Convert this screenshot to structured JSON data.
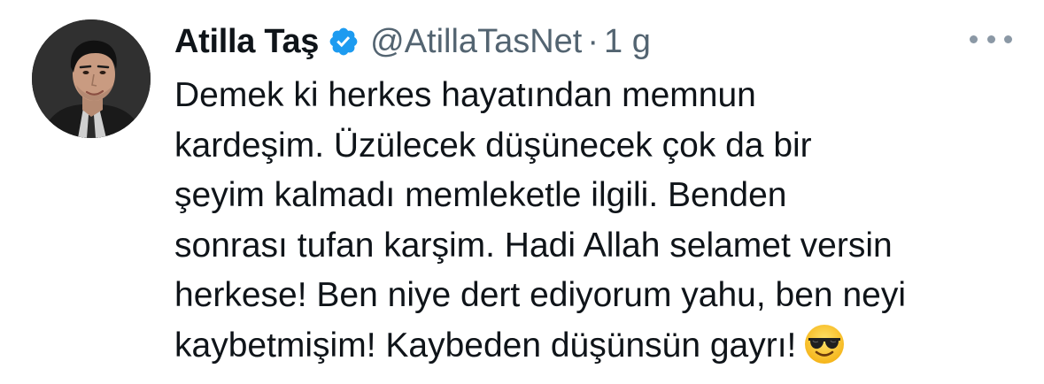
{
  "tweet": {
    "author": {
      "display_name": "Atilla Taş",
      "handle": "@AtillaTasNet",
      "verified": true,
      "verified_color": "#1d9bf0",
      "avatar_icon": "profile-photo"
    },
    "separator": "·",
    "time": "1 g",
    "more_icon": "more-horizontal-icon",
    "text_lines": [
      "Demek ki herkes hayatından memnun",
      "kardeşim. Üzülecek düşünecek çok da bir",
      "şeyim kalmadı memleketle ilgili. Benden",
      "sonrası tufan karşim. Hadi Allah selamet versin",
      "herkese! Ben niye dert ediyorum yahu, ben neyi",
      "kaybetmişim! Kaybeden düşünsün gayrı!"
    ],
    "emoji": "sunglasses-emoji"
  }
}
